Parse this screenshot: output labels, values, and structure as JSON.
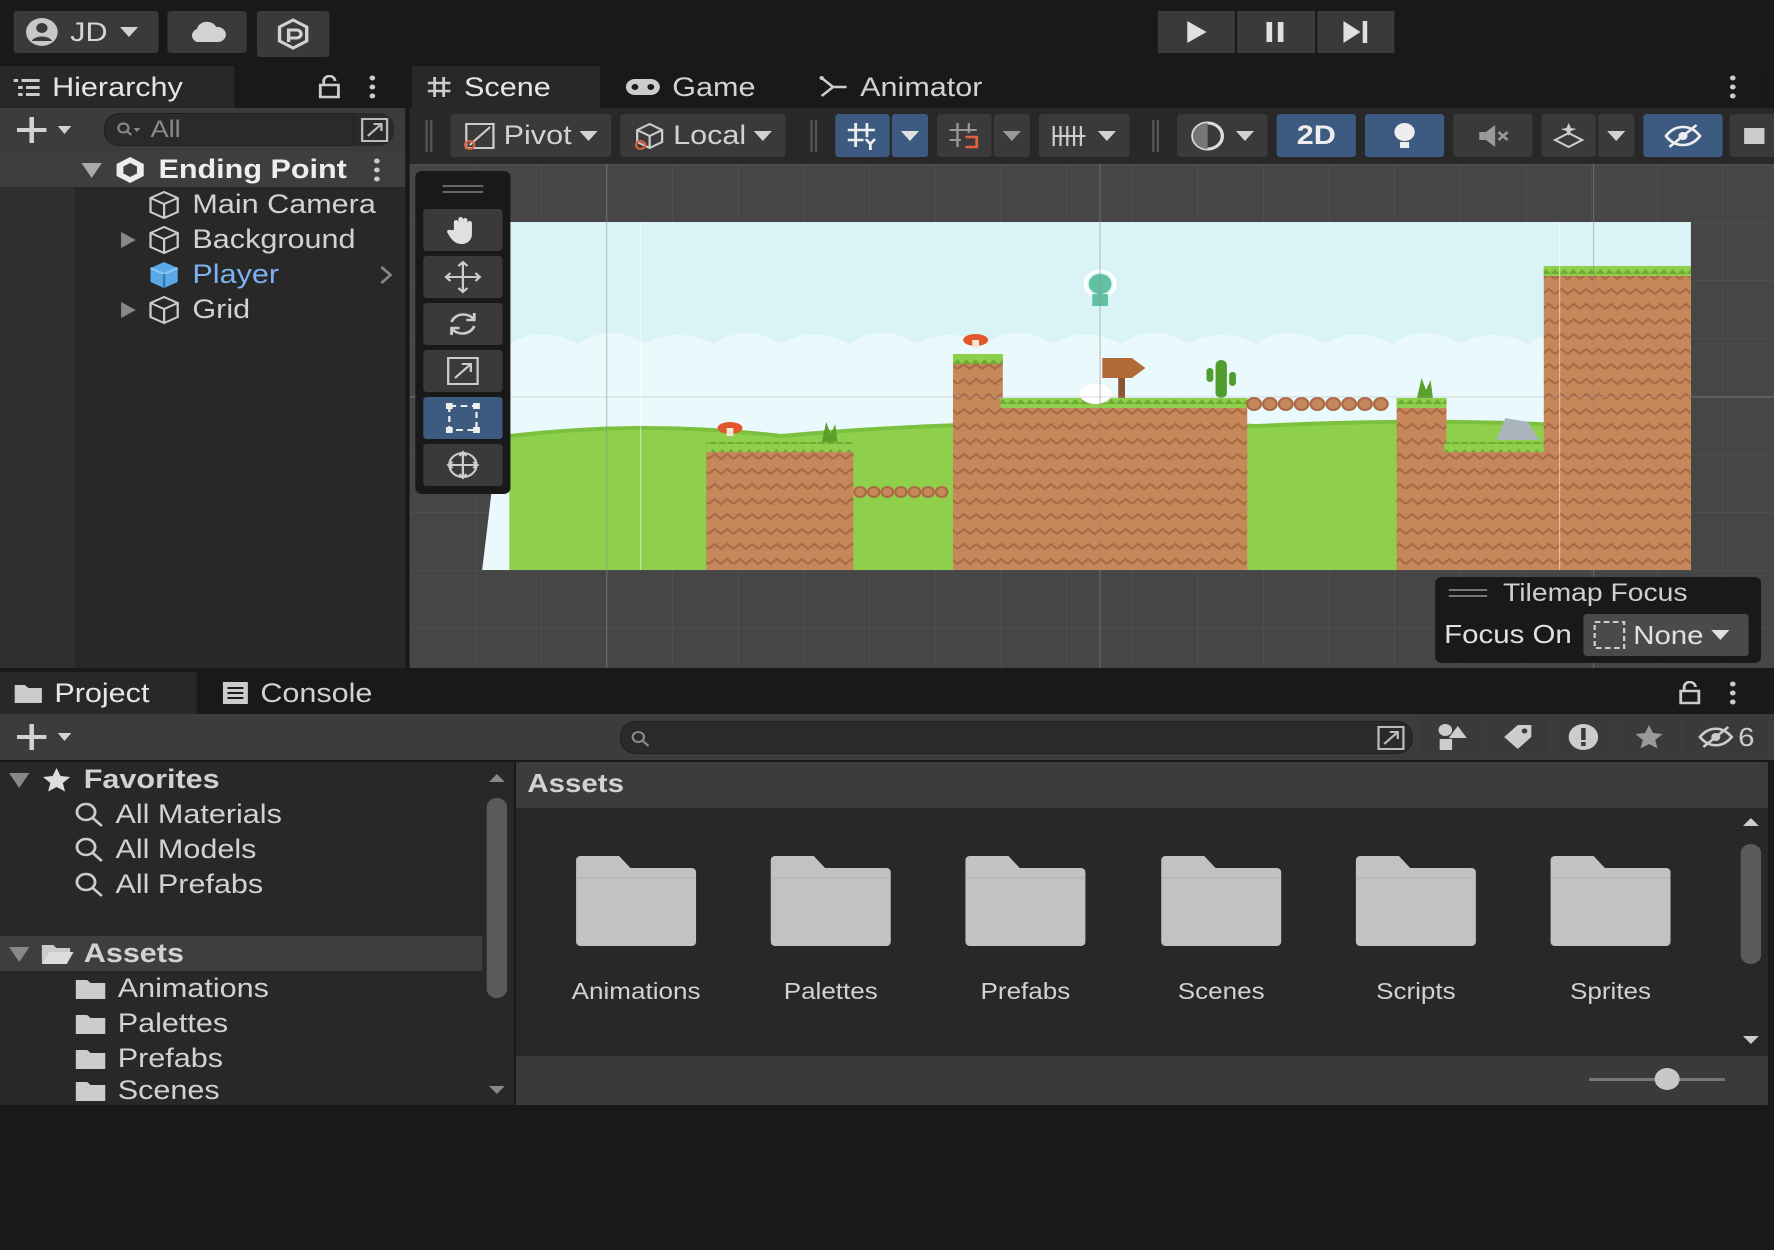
{
  "toolbar": {
    "account_label": "JD"
  },
  "hierarchy": {
    "tab_label": "Hierarchy",
    "search_placeholder": "All",
    "scene_name": "Ending Point",
    "items": [
      {
        "label": "Main Camera"
      },
      {
        "label": "Background"
      },
      {
        "label": "Player"
      },
      {
        "label": "Grid"
      }
    ]
  },
  "scene": {
    "tabs": [
      {
        "label": "Scene"
      },
      {
        "label": "Game"
      },
      {
        "label": "Animator"
      }
    ],
    "pivot_label": "Pivot",
    "local_label": "Local",
    "mode_2d_label": "2D",
    "tilemap_focus": {
      "title": "Tilemap Focus",
      "focus_on_label": "Focus On",
      "value": "None"
    }
  },
  "project": {
    "tabs": [
      {
        "label": "Project"
      },
      {
        "label": "Console"
      }
    ],
    "hidden_count": "6",
    "favorites_label": "Favorites",
    "favorites": [
      {
        "label": "All Materials"
      },
      {
        "label": "All Models"
      },
      {
        "label": "All Prefabs"
      }
    ],
    "assets_label": "Assets",
    "asset_folders_tree": [
      {
        "label": "Animations"
      },
      {
        "label": "Palettes"
      },
      {
        "label": "Prefabs"
      },
      {
        "label": "Scenes"
      }
    ],
    "breadcrumb": "Assets",
    "grid_folders": [
      {
        "label": "Animations"
      },
      {
        "label": "Palettes"
      },
      {
        "label": "Prefabs"
      },
      {
        "label": "Scenes"
      },
      {
        "label": "Scripts"
      },
      {
        "label": "Sprites"
      }
    ]
  },
  "colors": {
    "accent": "#3d5a80",
    "selected_text": "#7cb1f2",
    "sky": "#d9f3f6",
    "grass": "#8ed04c",
    "dirt": "#c6875a"
  }
}
